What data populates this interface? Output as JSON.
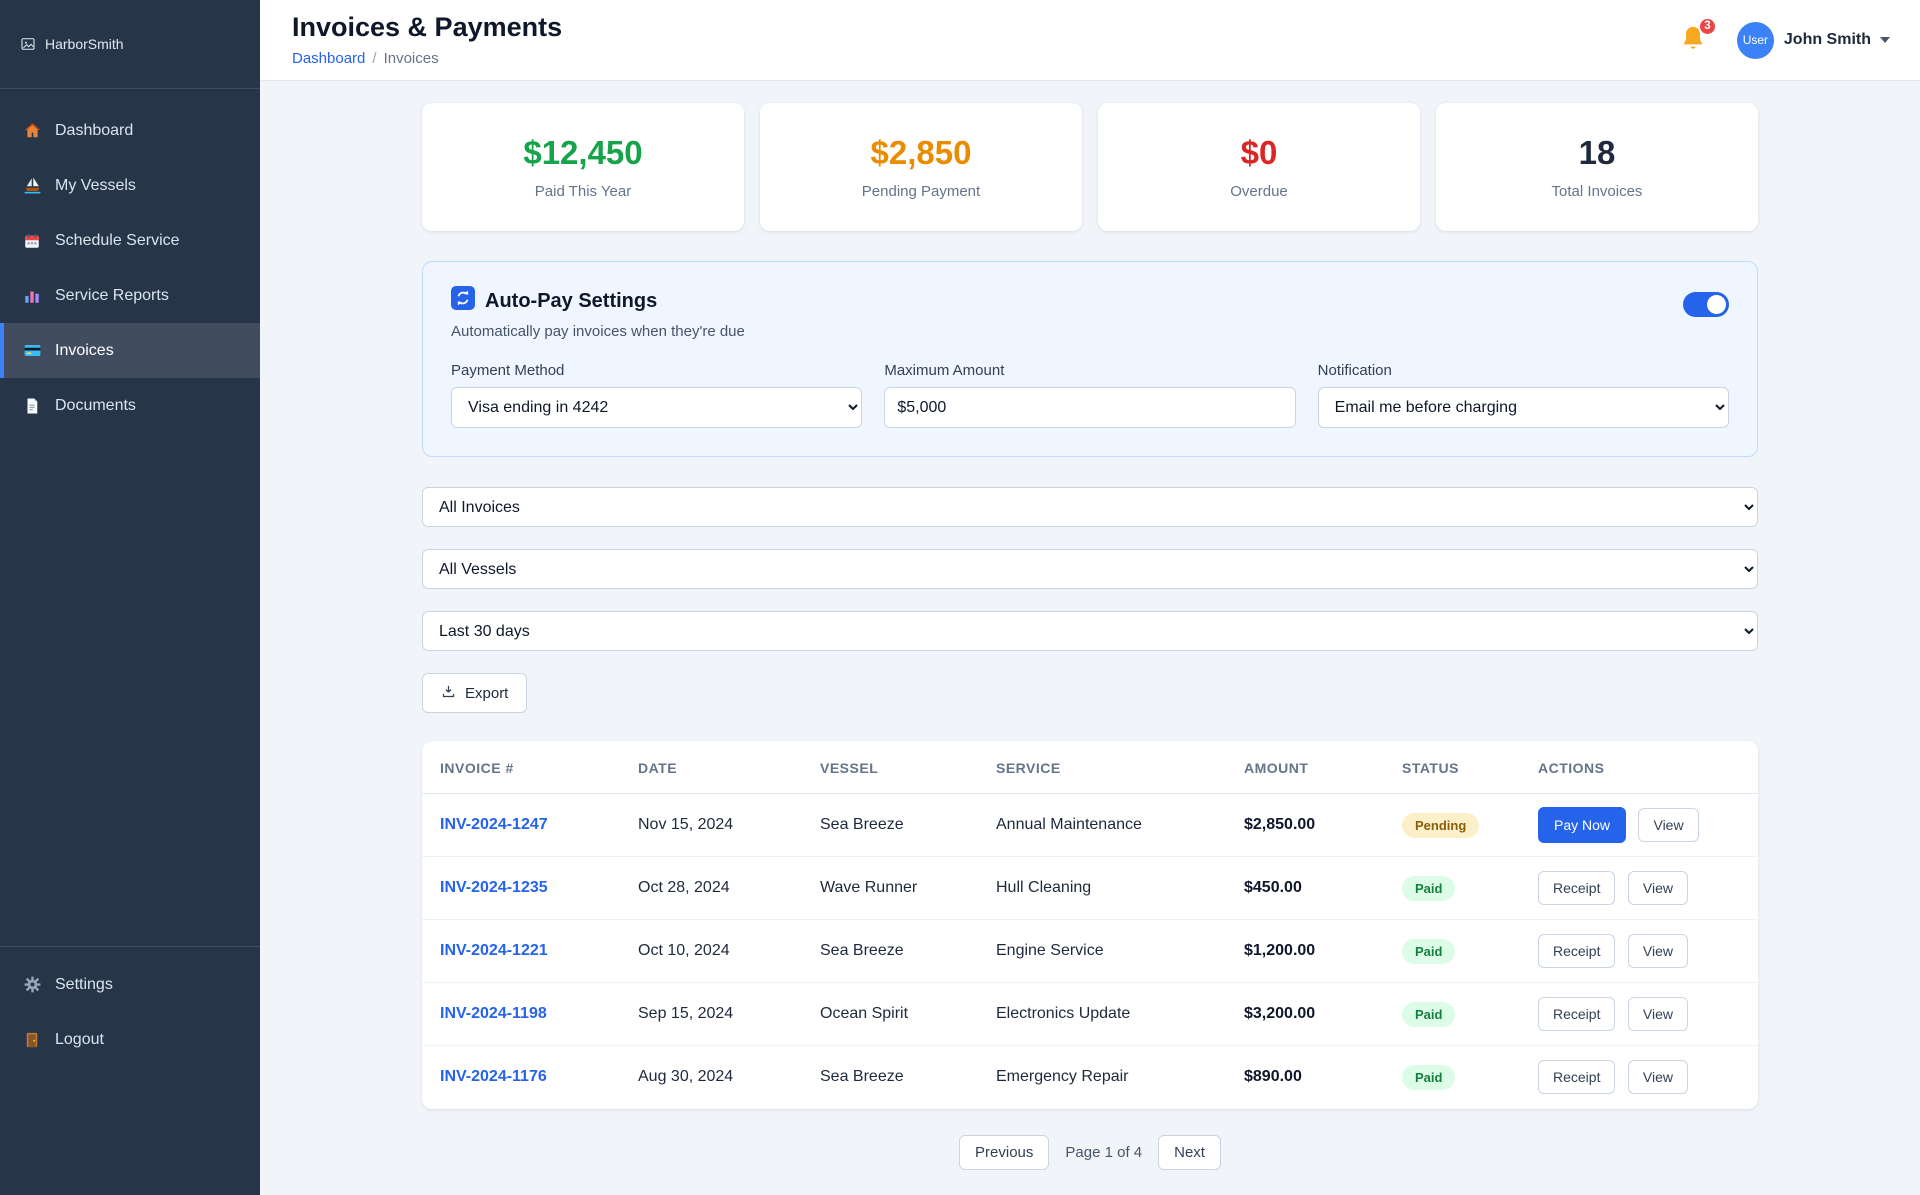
{
  "app": {
    "logo_alt": "HarborSmith"
  },
  "sidebar": {
    "items": [
      {
        "label": "Dashboard",
        "icon": "home-icon",
        "active": false
      },
      {
        "label": "My Vessels",
        "icon": "sailboat-icon",
        "active": false
      },
      {
        "label": "Schedule Service",
        "icon": "calendar-icon",
        "active": false
      },
      {
        "label": "Service Reports",
        "icon": "bar-chart-icon",
        "active": false
      },
      {
        "label": "Invoices",
        "icon": "credit-card-icon",
        "active": true
      },
      {
        "label": "Documents",
        "icon": "document-icon",
        "active": false
      }
    ],
    "footer_items": [
      {
        "label": "Settings",
        "icon": "gear-icon"
      },
      {
        "label": "Logout",
        "icon": "door-icon"
      }
    ]
  },
  "header": {
    "title": "Invoices & Payments",
    "breadcrumb": {
      "parent": "Dashboard",
      "separator": "/",
      "current": "Invoices"
    },
    "notifications": {
      "count": "3",
      "icon": "bell-icon"
    },
    "user": {
      "name": "John Smith",
      "avatar_alt": "User"
    }
  },
  "summary_cards": [
    {
      "value": "$12,450",
      "label": "Paid This Year",
      "color": "#16a34a"
    },
    {
      "value": "$2,850",
      "label": "Pending Payment",
      "color": "#ea8c00"
    },
    {
      "value": "$0",
      "label": "Overdue",
      "color": "#dc2626"
    },
    {
      "value": "18",
      "label": "Total Invoices",
      "color": "#1e293b"
    }
  ],
  "autopay": {
    "title": "Auto-Pay Settings",
    "subtitle": "Automatically pay invoices when they're due",
    "enabled": true,
    "icon": "autopay-icon",
    "payment_method": {
      "label": "Payment Method",
      "value": "Visa ending in 4242"
    },
    "maximum_amount": {
      "label": "Maximum Amount",
      "value": "$5,000"
    },
    "notification": {
      "label": "Notification",
      "value": "Email me before charging"
    }
  },
  "filters": {
    "invoice_filter": "All Invoices",
    "vessel_filter": "All Vessels",
    "date_filter": "Last 30 days"
  },
  "export_button": {
    "label": "Export",
    "icon": "export-icon"
  },
  "table": {
    "columns": [
      "INVOICE #",
      "DATE",
      "VESSEL",
      "SERVICE",
      "AMOUNT",
      "STATUS",
      "ACTIONS"
    ],
    "rows": [
      {
        "invoice": "INV-2024-1247",
        "date": "Nov 15, 2024",
        "vessel": "Sea Breeze",
        "service": "Annual Maintenance",
        "amount": "$2,850.00",
        "status": "Pending",
        "actions": [
          "Pay Now",
          "View"
        ]
      },
      {
        "invoice": "INV-2024-1235",
        "date": "Oct 28, 2024",
        "vessel": "Wave Runner",
        "service": "Hull Cleaning",
        "amount": "$450.00",
        "status": "Paid",
        "actions": [
          "Receipt",
          "View"
        ]
      },
      {
        "invoice": "INV-2024-1221",
        "date": "Oct 10, 2024",
        "vessel": "Sea Breeze",
        "service": "Engine Service",
        "amount": "$1,200.00",
        "status": "Paid",
        "actions": [
          "Receipt",
          "View"
        ]
      },
      {
        "invoice": "INV-2024-1198",
        "date": "Sep 15, 2024",
        "vessel": "Ocean Spirit",
        "service": "Electronics Update",
        "amount": "$3,200.00",
        "status": "Paid",
        "actions": [
          "Receipt",
          "View"
        ]
      },
      {
        "invoice": "INV-2024-1176",
        "date": "Aug 30, 2024",
        "vessel": "Sea Breeze",
        "service": "Emergency Repair",
        "amount": "$890.00",
        "status": "Paid",
        "actions": [
          "Receipt",
          "View"
        ]
      }
    ]
  },
  "pagination": {
    "previous": "Previous",
    "info": "Page 1 of 4",
    "next": "Next"
  }
}
